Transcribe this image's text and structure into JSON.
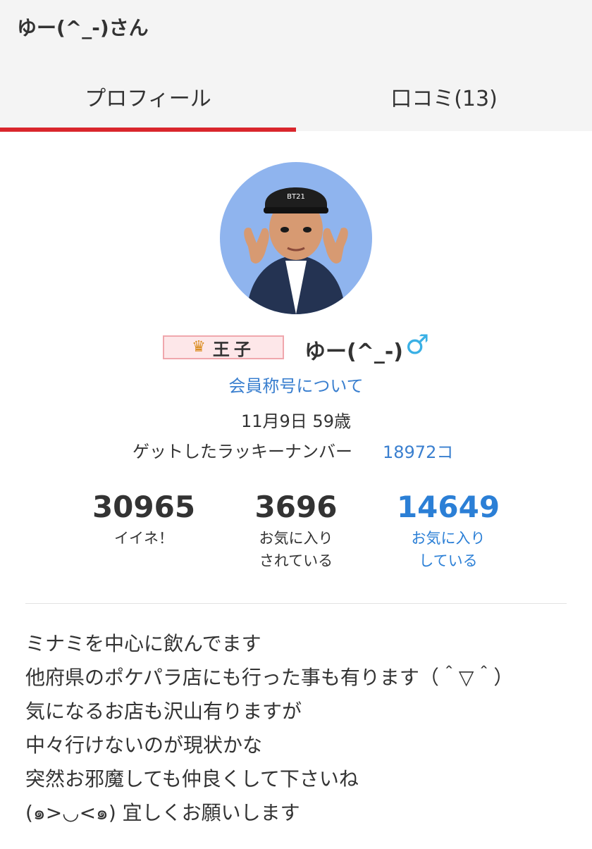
{
  "header": {
    "title": "ゆー(^_-)さん"
  },
  "tabs": [
    {
      "label": "プロフィール",
      "active": true
    },
    {
      "label": "口コミ(13)",
      "active": false
    }
  ],
  "profile": {
    "avatar_icon": "avatar-image",
    "rank_badge": "王子",
    "rank_icon": "crown-icon",
    "nickname": "ゆー(^_-)",
    "gender_symbol": "♂",
    "title_link": "会員称号について",
    "birth_age": "11月9日 59歳",
    "lucky_label": "ゲットしたラッキーナンバー",
    "lucky_value": "18972コ"
  },
  "stats": [
    {
      "value": "30965",
      "label_line1": "イイネ！",
      "label_line2": ""
    },
    {
      "value": "3696",
      "label_line1": "お気に入り",
      "label_line2": "されている"
    },
    {
      "value": "14649",
      "label_line1": "お気に入り",
      "label_line2": "している"
    }
  ],
  "bio": [
    "ミナミを中心に飲んでます",
    "他府県のポケパラ店にも行った事も有ります（＾▽＾）",
    "気になるお店も沢山有りますが",
    "中々行けないのが現状かな",
    "突然お邪魔しても仲良くして下さいね",
    "(๑>◡<๑) 宜しくお願いします"
  ],
  "colors": {
    "accent_red": "#d9262c",
    "link_blue": "#3a7fcf",
    "gender_blue": "#3ab0e5"
  }
}
